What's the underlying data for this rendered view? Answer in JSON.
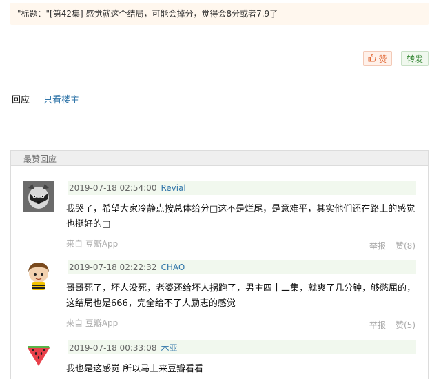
{
  "post": {
    "quote": "\"标题：\"[第42集] 感觉就这个结局，可能会掉分，觉得会8分或者7.9了"
  },
  "buttons": {
    "like_label": "赞",
    "share_label": "转发"
  },
  "tabs": [
    {
      "label": "回应"
    },
    {
      "label": "只看楼主"
    }
  ],
  "best_replies": {
    "header": "最赞回应",
    "comments": [
      {
        "date": "2019-07-18 02:54:00",
        "author": "Revial",
        "content": "我哭了，希望大家冷静点按总体给分□这不是烂尾，是意难平，其实他们还在路上的感觉也挺好的□",
        "source": "来自 豆瓣App",
        "report": "举报",
        "likes": "赞(8)"
      },
      {
        "date": "2019-07-18 02:22:32",
        "author": "CHAO",
        "content": "哥哥死了，坏人没死，老婆还给坏人拐跑了，男主四十二集，就爽了几分钟，够憋屈的，这结局也是666，完全给不了人励志的感觉",
        "source": "来自 豆瓣App",
        "report": "举报",
        "likes": "赞(5)"
      },
      {
        "date": "2019-07-18 00:33:08",
        "author": "木亚",
        "content": "我也是这感觉 所以马上来豆瓣看看"
      }
    ]
  },
  "colors": {
    "link": "#3377aa",
    "like_accent": "#e26a38",
    "share_accent": "#3a8a3a",
    "quote_bg": "#fff7ee",
    "meta_bg": "#f1f8ee"
  }
}
